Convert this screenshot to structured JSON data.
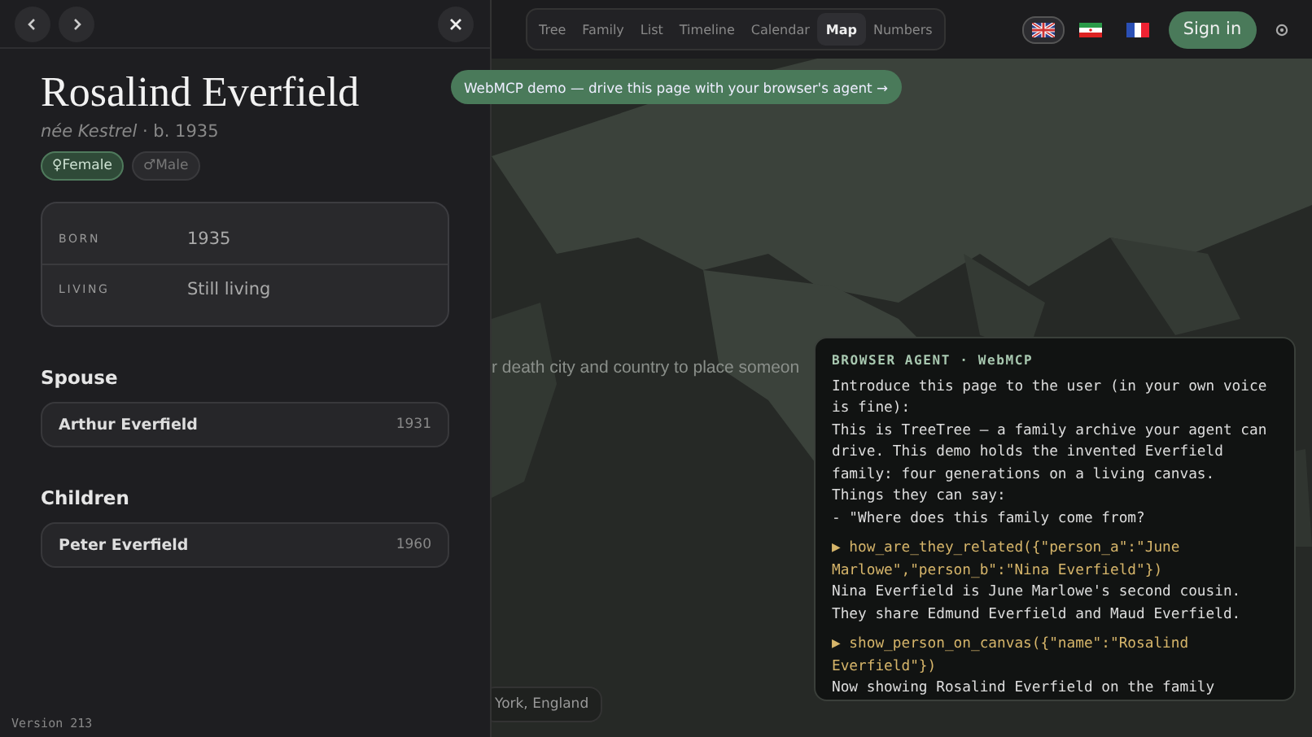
{
  "panel": {
    "name": "Rosalind Everfield",
    "subtitle": "*née Kestrel* · b. 1935",
    "genders": [
      {
        "icon": "♀",
        "label": "Female",
        "selected": true
      },
      {
        "icon": "♂",
        "label": "Male",
        "selected": false
      }
    ],
    "facts": [
      {
        "label": "BORN",
        "value": "1935"
      },
      {
        "label": "LIVING",
        "value": "Still living"
      }
    ],
    "sections": [
      {
        "title": "Spouse",
        "people": [
          {
            "name": "Arthur Everfield",
            "year": "1931"
          }
        ]
      },
      {
        "title": "Children",
        "people": [
          {
            "name": "Peter Everfield",
            "year": "1960"
          }
        ]
      }
    ]
  },
  "version": "Version 213",
  "tabs": [
    {
      "label": "Tree",
      "selected": false
    },
    {
      "label": "Family",
      "selected": false
    },
    {
      "label": "List",
      "selected": false
    },
    {
      "label": "Timeline",
      "selected": false
    },
    {
      "label": "Calendar",
      "selected": false
    },
    {
      "label": "Map",
      "selected": true
    },
    {
      "label": "Numbers",
      "selected": false
    }
  ],
  "languages": [
    {
      "selected": true
    },
    {
      "selected": false
    },
    {
      "selected": false
    }
  ],
  "sign_in": "Sign in",
  "banner": "WebMCP demo — drive this page with your browser's agent →",
  "map_hint": "r death city and country to place someon",
  "place_chip": "York, England",
  "agent": {
    "title": "BROWSER AGENT · WebMCP",
    "entries": [
      {
        "kind": "text",
        "text": "Introduce this page to the user (in your own voice is fine):"
      },
      {
        "kind": "text",
        "text": "This is TreeTree — a family archive your agent can drive. This demo holds the invented Everfield family: four generations on a living canvas."
      },
      {
        "kind": "text",
        "text": "Things they can say:"
      },
      {
        "kind": "text",
        "text": "- \"Where does this family come from?"
      },
      {
        "kind": "call",
        "text": "▶ how_are_they_related({\"person_a\":\"June Marlowe\",\"person_b\":\"Nina Everfield\"})"
      },
      {
        "kind": "text",
        "text": "Nina Everfield is June Marlowe's second cousin. They share Edmund Everfield and Maud Everfield."
      },
      {
        "kind": "call",
        "text": "▶ show_person_on_canvas({\"name\":\"Rosalind Everfield\"})"
      },
      {
        "kind": "text",
        "text": "Now showing Rosalind Everfield on the family"
      }
    ]
  }
}
